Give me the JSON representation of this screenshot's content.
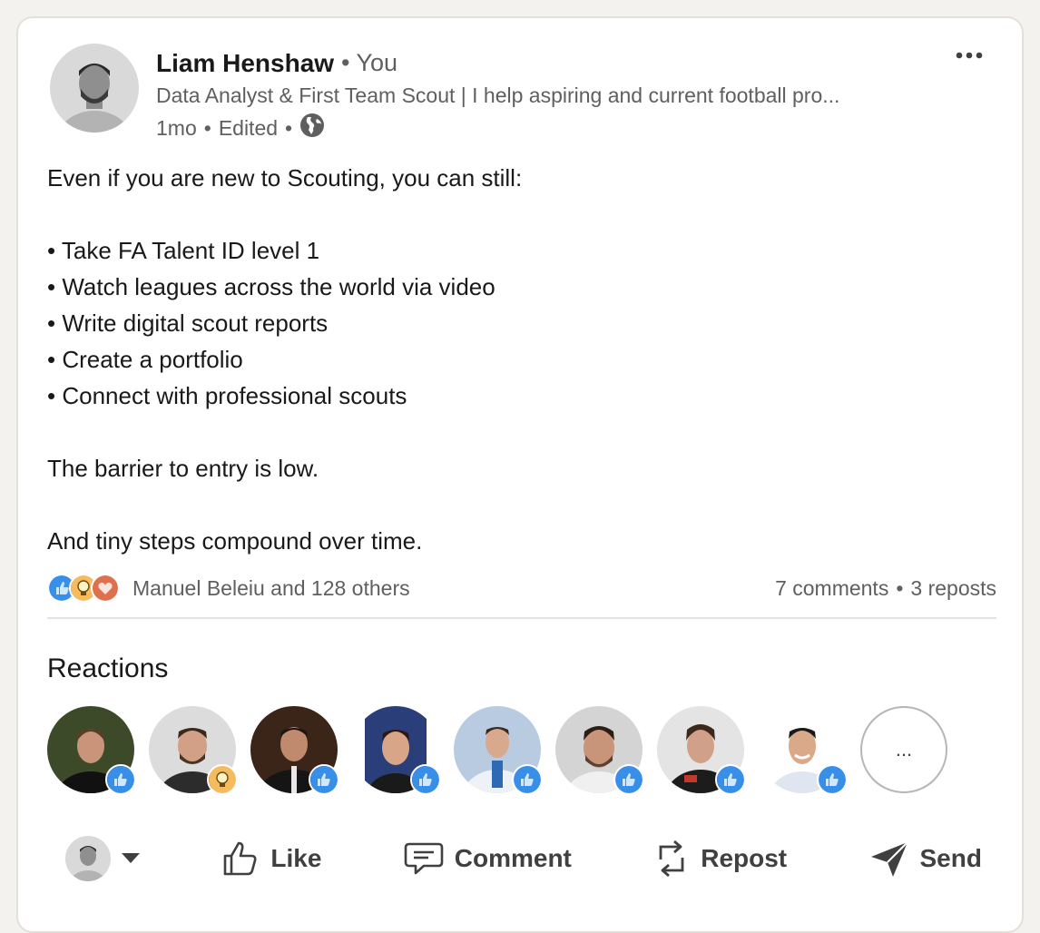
{
  "post": {
    "author_name": "Liam Henshaw",
    "author_tag": "• You",
    "headline": "Data Analyst & First Team Scout | I help aspiring and current football pro...",
    "time": "1mo",
    "edited": "Edited",
    "sep": "•",
    "body": {
      "intro": "Even if you are new to Scouting, you can still:",
      "bullets": [
        "• Take FA Talent ID level 1",
        "• Watch leagues across the world via video",
        "• Write digital scout reports",
        "• Create a portfolio",
        "• Connect with professional scouts"
      ],
      "line2": "The barrier to entry is low.",
      "line3": "And tiny steps compound over time."
    }
  },
  "stats": {
    "reactors_text": "Manuel Beleiu and 128 others",
    "comments": "7 comments",
    "sep": "•",
    "reposts": "3 reposts"
  },
  "reactions": {
    "title": "Reactions",
    "more_label": "...",
    "people": [
      {
        "badge": "like"
      },
      {
        "badge": "insightful"
      },
      {
        "badge": "like"
      },
      {
        "badge": "like"
      },
      {
        "badge": "like"
      },
      {
        "badge": "like"
      },
      {
        "badge": "like"
      },
      {
        "badge": "like"
      }
    ]
  },
  "actions": {
    "like": "Like",
    "comment": "Comment",
    "repost": "Repost",
    "send": "Send"
  },
  "colors": {
    "like_blue": "#378fe9",
    "insightful_yellow": "#f5bb5c",
    "love_red": "#df704d",
    "text_secondary": "#5f5f5f"
  }
}
